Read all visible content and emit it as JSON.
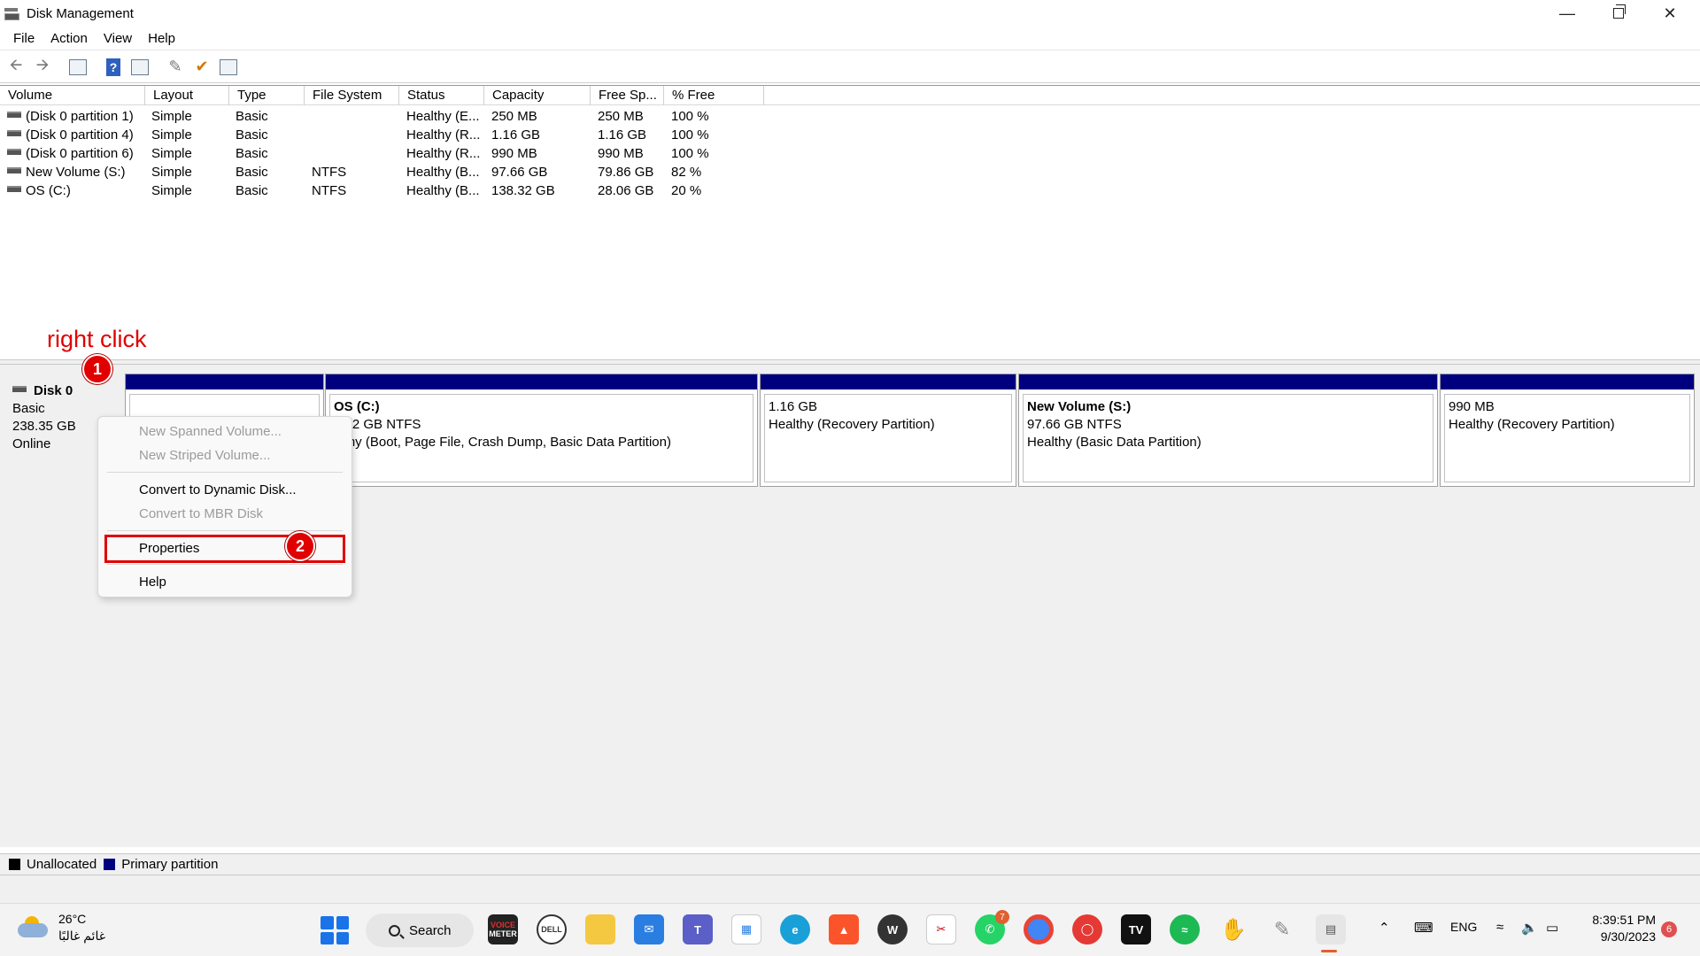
{
  "window": {
    "title": "Disk Management"
  },
  "menu": [
    "File",
    "Action",
    "View",
    "Help"
  ],
  "volume_table": {
    "columns": [
      "Volume",
      "Layout",
      "Type",
      "File System",
      "Status",
      "Capacity",
      "Free Sp...",
      "% Free"
    ],
    "rows": [
      [
        "(Disk 0 partition 1)",
        "Simple",
        "Basic",
        "",
        "Healthy (E...",
        "250 MB",
        "250 MB",
        "100 %"
      ],
      [
        "(Disk 0 partition 4)",
        "Simple",
        "Basic",
        "",
        "Healthy (R...",
        "1.16 GB",
        "1.16 GB",
        "100 %"
      ],
      [
        "(Disk 0 partition 6)",
        "Simple",
        "Basic",
        "",
        "Healthy (R...",
        "990 MB",
        "990 MB",
        "100 %"
      ],
      [
        "New Volume (S:)",
        "Simple",
        "Basic",
        "NTFS",
        "Healthy (B...",
        "97.66 GB",
        "79.86 GB",
        "82 %"
      ],
      [
        "OS (C:)",
        "Simple",
        "Basic",
        "NTFS",
        "Healthy (B...",
        "138.32 GB",
        "28.06 GB",
        "20 %"
      ]
    ]
  },
  "annotation": {
    "text": "right click",
    "step1": "1",
    "step2": "2"
  },
  "disk": {
    "name": "Disk 0",
    "type": "Basic",
    "size": "238.35 GB",
    "status": "Online"
  },
  "partitions": [
    {
      "name": "",
      "size": "",
      "status": ""
    },
    {
      "name": "OS  (C:)",
      "size": "3.32 GB NTFS",
      "status": "althy (Boot, Page File, Crash Dump, Basic Data Partition)"
    },
    {
      "name": "",
      "size": "1.16 GB",
      "status": "Healthy (Recovery Partition)"
    },
    {
      "name": "New Volume  (S:)",
      "size": "97.66 GB NTFS",
      "status": "Healthy (Basic Data Partition)"
    },
    {
      "name": "",
      "size": "990 MB",
      "status": "Healthy (Recovery Partition)"
    }
  ],
  "context_menu": {
    "new_spanned": "New Spanned Volume...",
    "new_striped": "New Striped Volume...",
    "convert_dynamic": "Convert to Dynamic Disk...",
    "convert_mbr": "Convert to MBR Disk",
    "properties": "Properties",
    "help": "Help"
  },
  "legend": {
    "unallocated": "Unallocated",
    "primary": "Primary partition",
    "unallocated_color": "#000000",
    "primary_color": "#00007f"
  },
  "taskbar": {
    "weather_temp": "26°C",
    "weather_desc": "غائم غالبًا",
    "search_label": "Search",
    "voicemeeter_label": "VOICE",
    "voicemeeter_sub": "METER",
    "dell_label": "DELL",
    "whatsapp_badge": "7",
    "lang": "ENG",
    "time": "8:39:51 PM",
    "date": "9/30/2023",
    "notifications": "6"
  }
}
